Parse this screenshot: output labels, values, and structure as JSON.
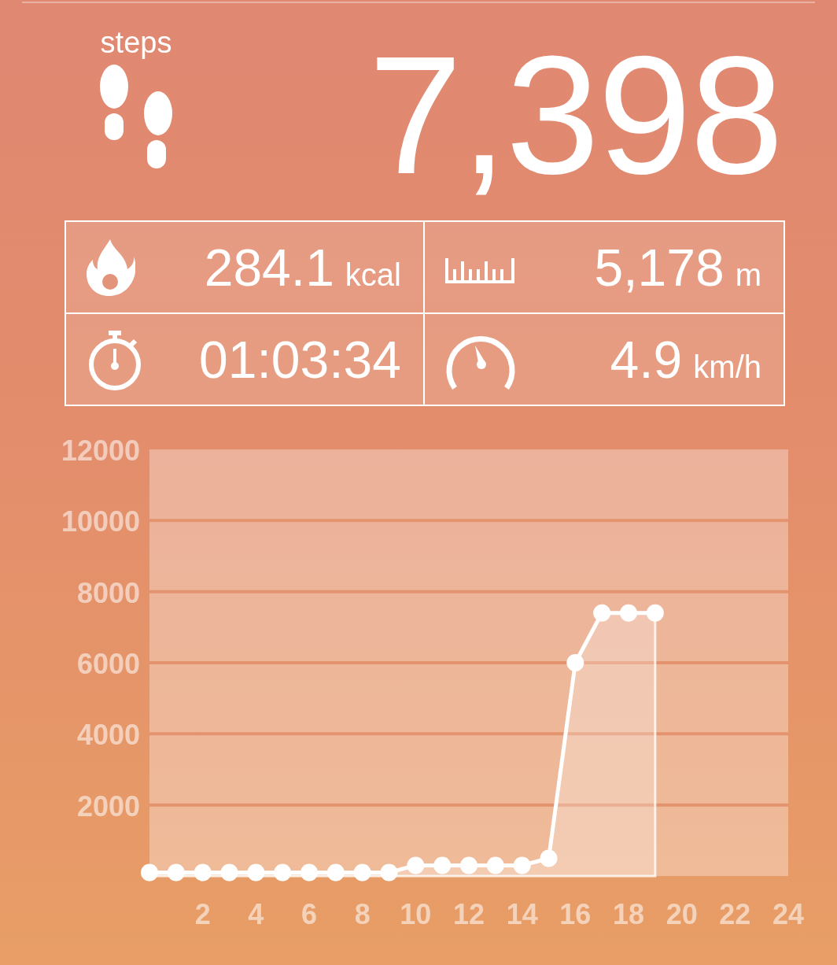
{
  "steps": {
    "label": "steps",
    "value": "7,398"
  },
  "stats": [
    {
      "kind": "calories",
      "value": "284.1",
      "unit": "kcal"
    },
    {
      "kind": "distance",
      "value": "5,178",
      "unit": "m"
    },
    {
      "kind": "duration",
      "value": "01:03:34"
    },
    {
      "kind": "speed",
      "value": "4.9",
      "unit": "km/h"
    }
  ],
  "chart": {
    "chart_data": {
      "type": "area",
      "x": [
        0,
        1,
        2,
        3,
        4,
        5,
        6,
        7,
        8,
        9,
        10,
        11,
        12,
        13,
        14,
        15,
        16,
        17,
        18,
        19
      ],
      "values": [
        100,
        100,
        100,
        100,
        100,
        100,
        100,
        100,
        100,
        100,
        300,
        300,
        300,
        300,
        300,
        500,
        6000,
        7400,
        7400,
        7400
      ],
      "grid": true,
      "xlim": [
        0,
        24
      ],
      "ylim": [
        0,
        12000
      ],
      "xticks": [
        2,
        4,
        6,
        8,
        10,
        12,
        14,
        16,
        18,
        20,
        22,
        24
      ],
      "yticks": [
        2000,
        4000,
        6000,
        8000,
        10000,
        12000
      ]
    }
  }
}
